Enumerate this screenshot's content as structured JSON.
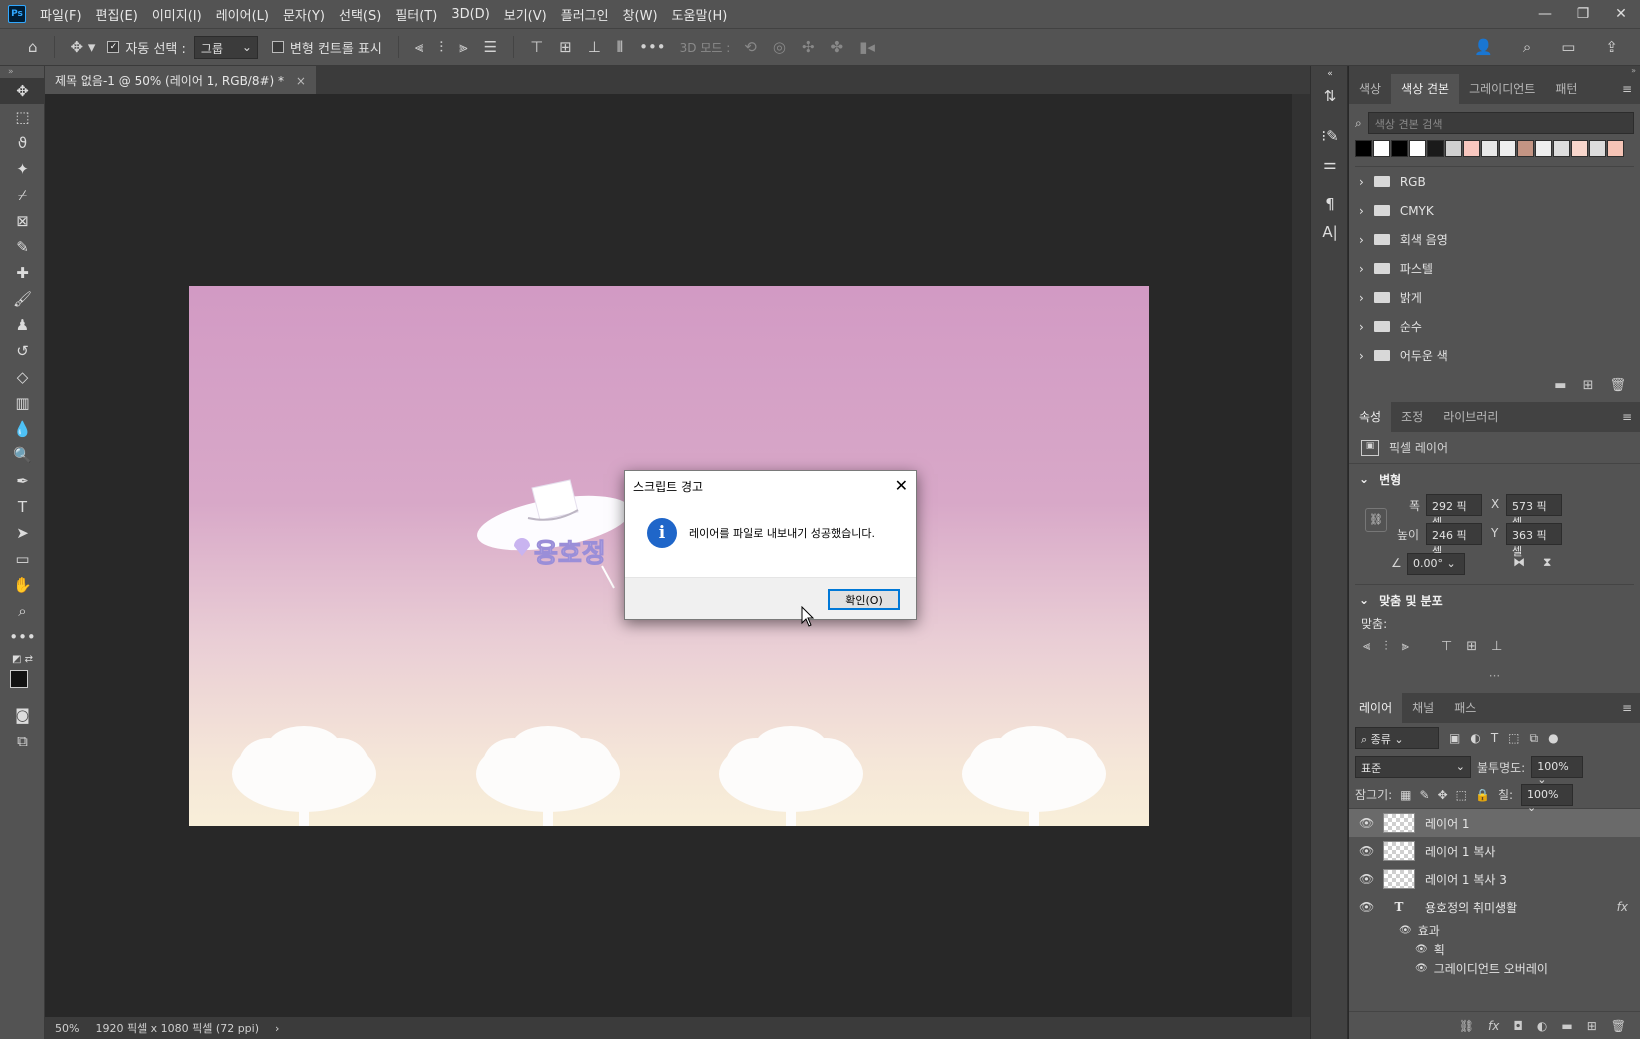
{
  "app": {
    "logo": "Ps"
  },
  "menu": [
    "파일(F)",
    "편집(E)",
    "이미지(I)",
    "레이어(L)",
    "문자(Y)",
    "선택(S)",
    "필터(T)",
    "3D(D)",
    "보기(V)",
    "플러그인",
    "창(W)",
    "도움말(H)"
  ],
  "options": {
    "auto_select_label": "자동 선택 :",
    "auto_select_value": "그룹",
    "transform_label": "변형 컨트롤 표시",
    "mode_label": "3D 모드 :"
  },
  "document": {
    "tab_title": "제목 없음-1 @ 50% (레이어 1, RGB/8#) *",
    "zoom": "50%",
    "info": "1920 픽셀 x 1080 픽셀 (72 ppi)"
  },
  "artwork": {
    "logo_text": "용호정"
  },
  "dialog": {
    "title": "스크립트 경고",
    "message": "레이어를 파일로 내보내기 성공했습니다.",
    "ok_label": "확인(O)",
    "info_glyph": "i"
  },
  "swatches_panel": {
    "tabs": [
      "색상",
      "색상 견본",
      "그레이디언트",
      "패턴"
    ],
    "active_tab": 1,
    "search_placeholder": "색상 견본 검색",
    "colors": [
      "#000000",
      "#ffffff",
      "#000000",
      "#ffffff",
      "#1a1a1a",
      "#d0d0d0",
      "#f8c7bf",
      "#e8e8e8",
      "#eeeeee",
      "#c49584",
      "#eeeeee",
      "#dddddd",
      "#f8d6cc",
      "#dcdcdc",
      "#f5c4b6"
    ],
    "folders": [
      "RGB",
      "CMYK",
      "회색 음영",
      "파스텔",
      "밝게",
      "순수",
      "어두운 색"
    ]
  },
  "properties_panel": {
    "tabs": [
      "속성",
      "조정",
      "라이브러리"
    ],
    "layer_type": "픽셀 레이어",
    "transform_title": "변형",
    "width_label": "폭",
    "width_value": "292 픽셀",
    "height_label": "높이",
    "height_value": "246 픽셀",
    "x_label": "X",
    "x_value": "573 픽셀",
    "y_label": "Y",
    "y_value": "363 픽셀",
    "angle_value": "0.00°",
    "align_title": "맞춤 및 분포",
    "align_label": "맞춤:"
  },
  "layers_panel": {
    "tabs": [
      "레이어",
      "채널",
      "패스"
    ],
    "filter_value": "종류",
    "blend_mode": "표준",
    "opacity_label": "불투명도:",
    "opacity_value": "100%",
    "lock_label": "잠그기:",
    "fill_label": "칠:",
    "fill_value": "100%",
    "layers": [
      "레이어 1",
      "레이어 1 복사",
      "레이어 1 복사 3"
    ],
    "text_layer": "용호정의 취미생활",
    "effects_label": "효과",
    "effect_items": [
      "획",
      "그레이디언트 오버레이"
    ],
    "fx_label": "fx"
  }
}
